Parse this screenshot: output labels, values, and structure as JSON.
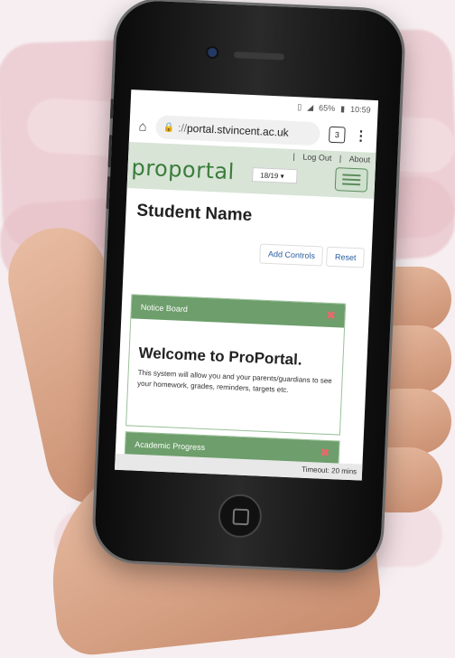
{
  "status_bar": {
    "battery": "65%",
    "time": "10:59"
  },
  "browser": {
    "url_scheme": "://",
    "url_host": "portal.stvincent.ac.uk",
    "tabs_count": "3"
  },
  "site_header": {
    "logo": "proportal",
    "links": [
      "|",
      "Log Out",
      "|",
      "About"
    ],
    "year_select": "18/19"
  },
  "page": {
    "title": "Student Name",
    "buttons": {
      "add_controls": "Add Controls",
      "reset": "Reset"
    }
  },
  "panels": [
    {
      "title": "Notice Board",
      "heading": "Welcome to ProPortal.",
      "body": "This system will allow you and your parents/guardians to see your homework, grades, reminders, targets etc."
    },
    {
      "title": "Academic Progress"
    }
  ],
  "footer": {
    "timeout": "Timeout: 20 mins"
  },
  "colors": {
    "header_bg": "#d7e4d6",
    "panel_header": "#6d9e6b",
    "logo": "#3a7d3b"
  }
}
